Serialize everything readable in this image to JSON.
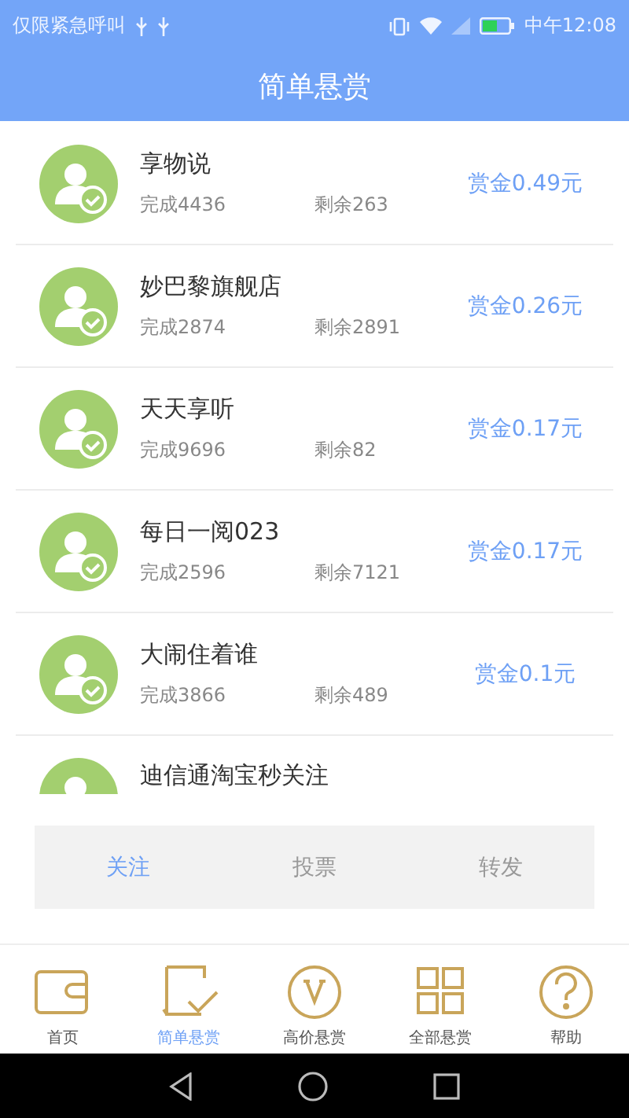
{
  "status_bar": {
    "carrier": "仅限紧急呼叫",
    "time": "中午12:08"
  },
  "header": {
    "title": "简单悬赏"
  },
  "tasks": [
    {
      "name": "享物说",
      "done": "完成4436",
      "left": "剩余263",
      "reward": "赏金0.49元"
    },
    {
      "name": "妙巴黎旗舰店",
      "done": "完成2874",
      "left": "剩余2891",
      "reward": "赏金0.26元"
    },
    {
      "name": "天天享听",
      "done": "完成9696",
      "left": "剩余82",
      "reward": "赏金0.17元"
    },
    {
      "name": "每日一阅023",
      "done": "完成2596",
      "left": "剩余7121",
      "reward": "赏金0.17元"
    },
    {
      "name": "大闹住着谁",
      "done": "完成3866",
      "left": "剩余489",
      "reward": "赏金0.1元"
    },
    {
      "name": "迪信通淘宝秒关注"
    }
  ],
  "filter_tabs": [
    {
      "label": "关注",
      "selected": true
    },
    {
      "label": "投票",
      "selected": false
    },
    {
      "label": "转发",
      "selected": false
    }
  ],
  "bottom_nav": [
    {
      "label": "首页",
      "kind": "wallet",
      "selected": false
    },
    {
      "label": "简单悬赏",
      "kind": "document",
      "selected": true
    },
    {
      "label": "高价悬赏",
      "kind": "vcircle",
      "selected": false
    },
    {
      "label": "全部悬赏",
      "kind": "grid",
      "selected": false
    },
    {
      "label": "帮助",
      "kind": "help",
      "selected": false
    }
  ]
}
